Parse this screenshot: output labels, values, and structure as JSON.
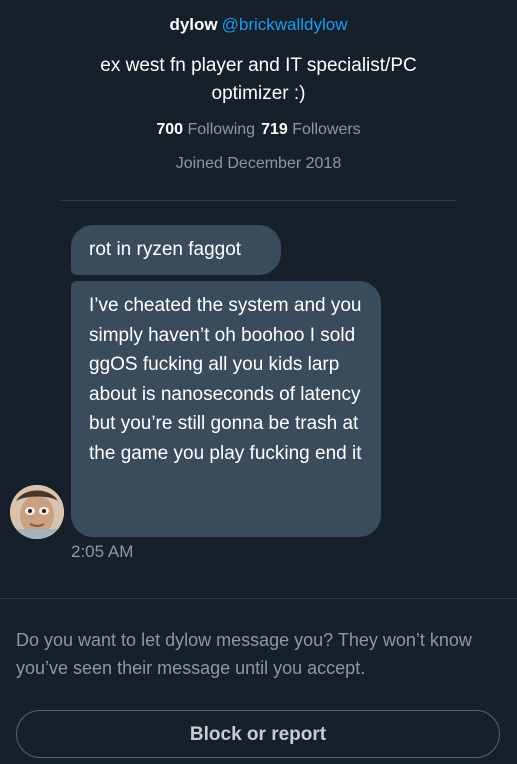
{
  "profile": {
    "display_name": "dylow",
    "handle": "@brickwalldylow",
    "bio": "ex west fn player and IT specialist/PC optimizer :)",
    "following_count": "700",
    "following_label": "Following",
    "followers_count": "719",
    "followers_label": "Followers",
    "joined": "Joined December 2018"
  },
  "conversation": {
    "messages": [
      {
        "text": "rot in ryzen faggot"
      },
      {
        "text": "I’ve cheated the system and you simply haven’t oh boohoo I sold ggOS fucking all you kids larp about is nanoseconds of latency but you’re still gonna be trash at the game you play fucking end it"
      }
    ],
    "timestamp": "2:05 AM",
    "avatar_icon": "user-avatar-photo"
  },
  "request": {
    "prompt": "Do you want to let dylow message you? They won’t know you’ve seen their message until you accept.",
    "block_label": "Block or report"
  },
  "colors": {
    "background": "#15202b",
    "bubble": "#3a4c5c",
    "link": "#1d9bf0",
    "secondary_text": "#8b98a5"
  }
}
